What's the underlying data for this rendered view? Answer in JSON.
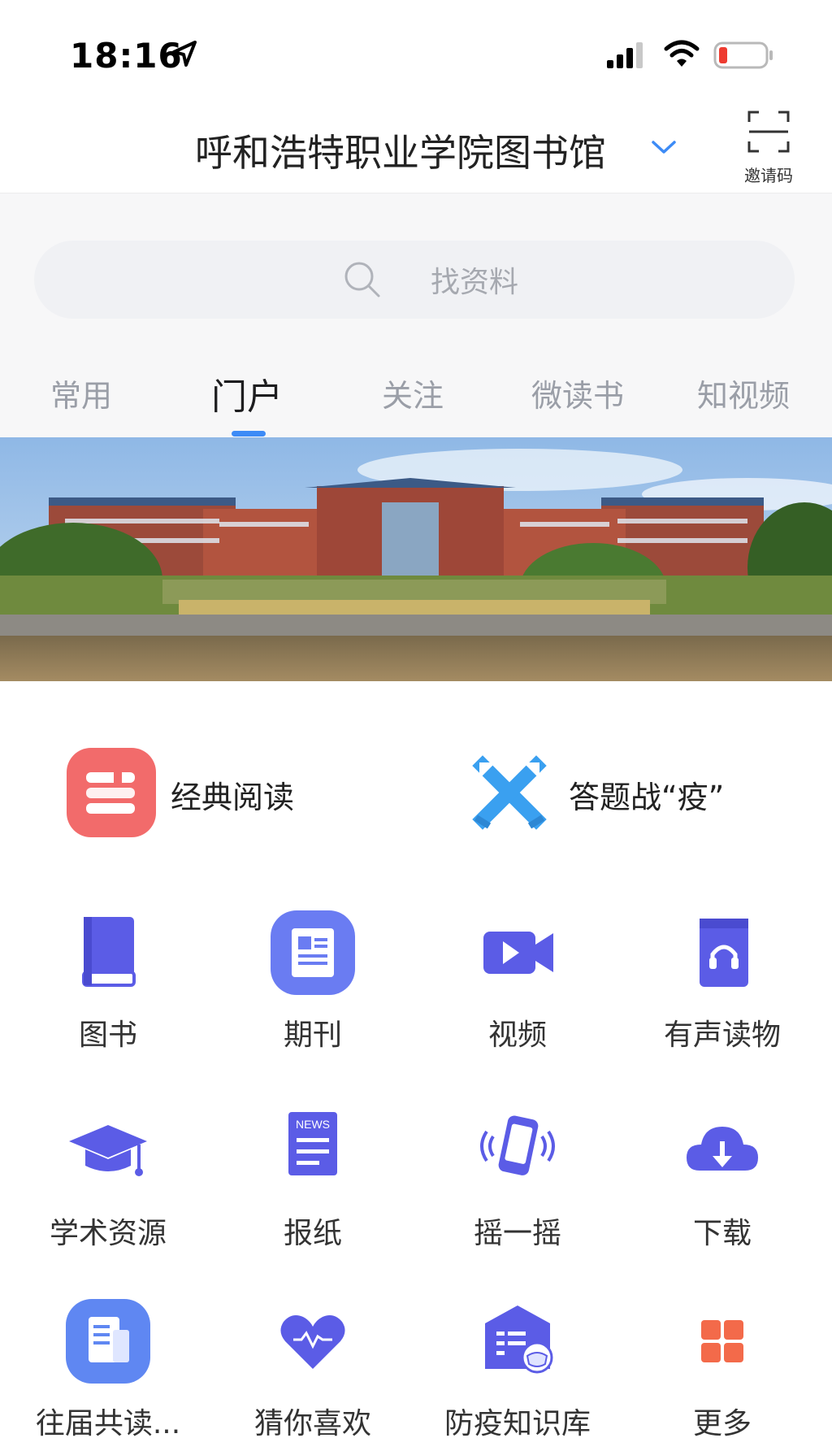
{
  "status_bar": {
    "time": "18:16"
  },
  "header": {
    "title": "呼和浩特职业学院图书馆",
    "invite_label": "邀请码"
  },
  "search": {
    "placeholder": "找资料"
  },
  "tabs": [
    {
      "label": "常用"
    },
    {
      "label": "门户"
    },
    {
      "label": "关注"
    },
    {
      "label": "微读书"
    },
    {
      "label": "知视频"
    }
  ],
  "active_tab": "门户",
  "features": [
    {
      "label": "经典阅读",
      "icon": "books-icon"
    },
    {
      "label": "答题战“疫”",
      "icon": "crossed-swords-icon"
    }
  ],
  "grid": [
    {
      "label": "图书",
      "icon": "book-icon"
    },
    {
      "label": "期刊",
      "icon": "journal-icon"
    },
    {
      "label": "视频",
      "icon": "video-camera-icon"
    },
    {
      "label": "有声读物",
      "icon": "audiobook-icon"
    },
    {
      "label": "学术资源",
      "icon": "graduation-cap-icon"
    },
    {
      "label": "报纸",
      "icon": "newspaper-icon"
    },
    {
      "label": "摇一摇",
      "icon": "shake-phone-icon"
    },
    {
      "label": "下载",
      "icon": "cloud-download-icon"
    },
    {
      "label": "往届共读...",
      "icon": "document-icon"
    },
    {
      "label": "猜你喜欢",
      "icon": "heart-icon"
    },
    {
      "label": "防疫知识库",
      "icon": "mask-house-icon"
    },
    {
      "label": "更多",
      "icon": "grid-more-icon"
    }
  ],
  "grid_badge": "NEWS",
  "colors": {
    "accent": "#3d8bf6",
    "icon_purple": "#5b5ce6",
    "feature_red": "#f26b6b",
    "more_orange": "#f36a4a",
    "cross_blue": "#3aa0f0"
  }
}
